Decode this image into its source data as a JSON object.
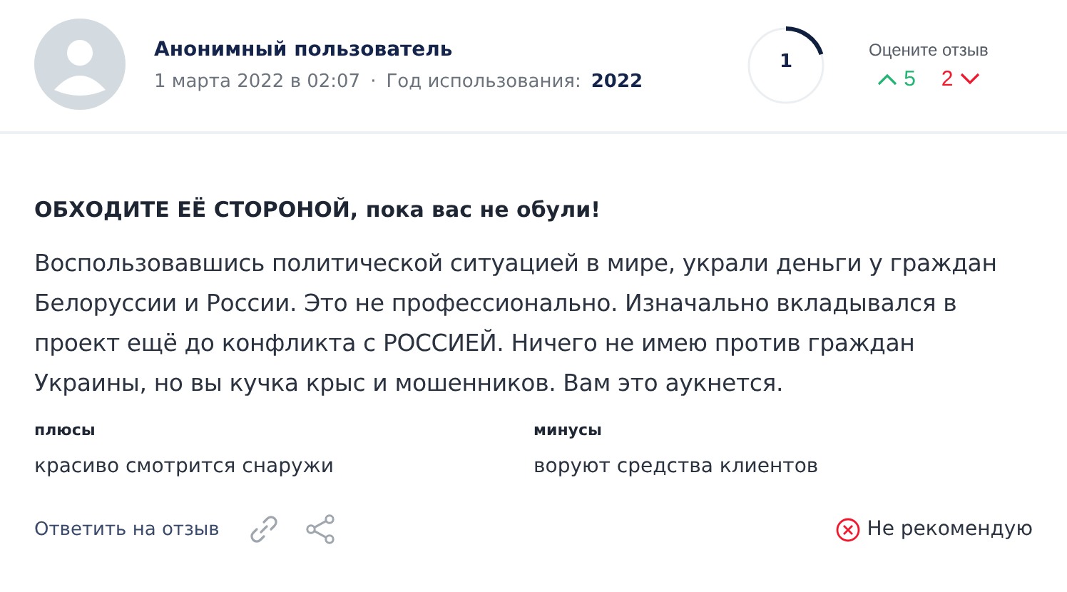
{
  "author": {
    "name": "Анонимный пользователь",
    "date": "1 марта 2022 в 02:07",
    "separator": "·",
    "usage_label": "Год использования:",
    "usage_year": "2022"
  },
  "score": {
    "value": "1"
  },
  "rate": {
    "label": "Оцените отзыв",
    "up": "5",
    "down": "2"
  },
  "review": {
    "title": "ОБХОДИТЕ ЕЁ СТОРОНОЙ, пока вас не обули!",
    "text": "Воспользовавшись политической ситуацией в мире, украли деньги у граждан Белоруссии и России. Это не профессионально. Изначально вкладывался в проект ещё до конфликта с РОССИЕЙ. Ничего не имею против граждан Украины, но вы кучка крыс и мошенников. Вам это аукнется."
  },
  "pros": {
    "label": "плюсы",
    "text": "красиво смотрится снаружи"
  },
  "cons": {
    "label": "минусы",
    "text": "воруют средства клиентов"
  },
  "footer": {
    "reply": "Ответить на отзыв",
    "verdict": "Не рекомендую"
  }
}
